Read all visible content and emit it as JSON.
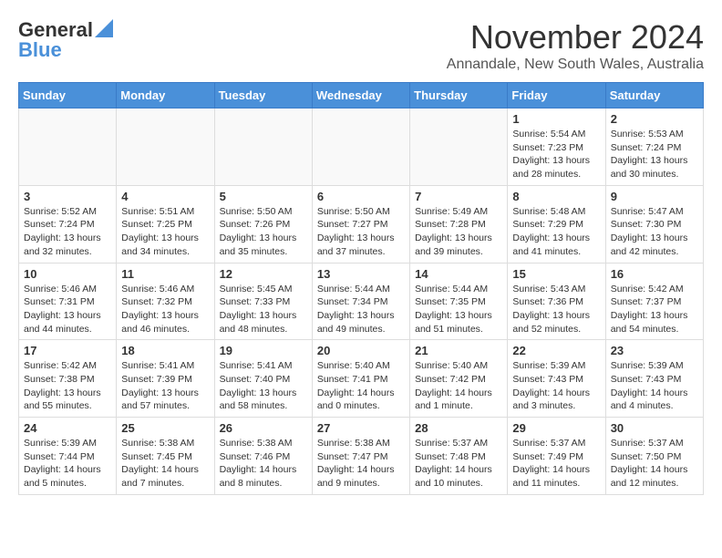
{
  "header": {
    "logo_general": "General",
    "logo_blue": "Blue",
    "month": "November 2024",
    "location": "Annandale, New South Wales, Australia"
  },
  "weekdays": [
    "Sunday",
    "Monday",
    "Tuesday",
    "Wednesday",
    "Thursday",
    "Friday",
    "Saturday"
  ],
  "weeks": [
    [
      {
        "day": "",
        "info": ""
      },
      {
        "day": "",
        "info": ""
      },
      {
        "day": "",
        "info": ""
      },
      {
        "day": "",
        "info": ""
      },
      {
        "day": "",
        "info": ""
      },
      {
        "day": "1",
        "info": "Sunrise: 5:54 AM\nSunset: 7:23 PM\nDaylight: 13 hours and 28 minutes."
      },
      {
        "day": "2",
        "info": "Sunrise: 5:53 AM\nSunset: 7:24 PM\nDaylight: 13 hours and 30 minutes."
      }
    ],
    [
      {
        "day": "3",
        "info": "Sunrise: 5:52 AM\nSunset: 7:24 PM\nDaylight: 13 hours and 32 minutes."
      },
      {
        "day": "4",
        "info": "Sunrise: 5:51 AM\nSunset: 7:25 PM\nDaylight: 13 hours and 34 minutes."
      },
      {
        "day": "5",
        "info": "Sunrise: 5:50 AM\nSunset: 7:26 PM\nDaylight: 13 hours and 35 minutes."
      },
      {
        "day": "6",
        "info": "Sunrise: 5:50 AM\nSunset: 7:27 PM\nDaylight: 13 hours and 37 minutes."
      },
      {
        "day": "7",
        "info": "Sunrise: 5:49 AM\nSunset: 7:28 PM\nDaylight: 13 hours and 39 minutes."
      },
      {
        "day": "8",
        "info": "Sunrise: 5:48 AM\nSunset: 7:29 PM\nDaylight: 13 hours and 41 minutes."
      },
      {
        "day": "9",
        "info": "Sunrise: 5:47 AM\nSunset: 7:30 PM\nDaylight: 13 hours and 42 minutes."
      }
    ],
    [
      {
        "day": "10",
        "info": "Sunrise: 5:46 AM\nSunset: 7:31 PM\nDaylight: 13 hours and 44 minutes."
      },
      {
        "day": "11",
        "info": "Sunrise: 5:46 AM\nSunset: 7:32 PM\nDaylight: 13 hours and 46 minutes."
      },
      {
        "day": "12",
        "info": "Sunrise: 5:45 AM\nSunset: 7:33 PM\nDaylight: 13 hours and 48 minutes."
      },
      {
        "day": "13",
        "info": "Sunrise: 5:44 AM\nSunset: 7:34 PM\nDaylight: 13 hours and 49 minutes."
      },
      {
        "day": "14",
        "info": "Sunrise: 5:44 AM\nSunset: 7:35 PM\nDaylight: 13 hours and 51 minutes."
      },
      {
        "day": "15",
        "info": "Sunrise: 5:43 AM\nSunset: 7:36 PM\nDaylight: 13 hours and 52 minutes."
      },
      {
        "day": "16",
        "info": "Sunrise: 5:42 AM\nSunset: 7:37 PM\nDaylight: 13 hours and 54 minutes."
      }
    ],
    [
      {
        "day": "17",
        "info": "Sunrise: 5:42 AM\nSunset: 7:38 PM\nDaylight: 13 hours and 55 minutes."
      },
      {
        "day": "18",
        "info": "Sunrise: 5:41 AM\nSunset: 7:39 PM\nDaylight: 13 hours and 57 minutes."
      },
      {
        "day": "19",
        "info": "Sunrise: 5:41 AM\nSunset: 7:40 PM\nDaylight: 13 hours and 58 minutes."
      },
      {
        "day": "20",
        "info": "Sunrise: 5:40 AM\nSunset: 7:41 PM\nDaylight: 14 hours and 0 minutes."
      },
      {
        "day": "21",
        "info": "Sunrise: 5:40 AM\nSunset: 7:42 PM\nDaylight: 14 hours and 1 minute."
      },
      {
        "day": "22",
        "info": "Sunrise: 5:39 AM\nSunset: 7:43 PM\nDaylight: 14 hours and 3 minutes."
      },
      {
        "day": "23",
        "info": "Sunrise: 5:39 AM\nSunset: 7:43 PM\nDaylight: 14 hours and 4 minutes."
      }
    ],
    [
      {
        "day": "24",
        "info": "Sunrise: 5:39 AM\nSunset: 7:44 PM\nDaylight: 14 hours and 5 minutes."
      },
      {
        "day": "25",
        "info": "Sunrise: 5:38 AM\nSunset: 7:45 PM\nDaylight: 14 hours and 7 minutes."
      },
      {
        "day": "26",
        "info": "Sunrise: 5:38 AM\nSunset: 7:46 PM\nDaylight: 14 hours and 8 minutes."
      },
      {
        "day": "27",
        "info": "Sunrise: 5:38 AM\nSunset: 7:47 PM\nDaylight: 14 hours and 9 minutes."
      },
      {
        "day": "28",
        "info": "Sunrise: 5:37 AM\nSunset: 7:48 PM\nDaylight: 14 hours and 10 minutes."
      },
      {
        "day": "29",
        "info": "Sunrise: 5:37 AM\nSunset: 7:49 PM\nDaylight: 14 hours and 11 minutes."
      },
      {
        "day": "30",
        "info": "Sunrise: 5:37 AM\nSunset: 7:50 PM\nDaylight: 14 hours and 12 minutes."
      }
    ]
  ]
}
